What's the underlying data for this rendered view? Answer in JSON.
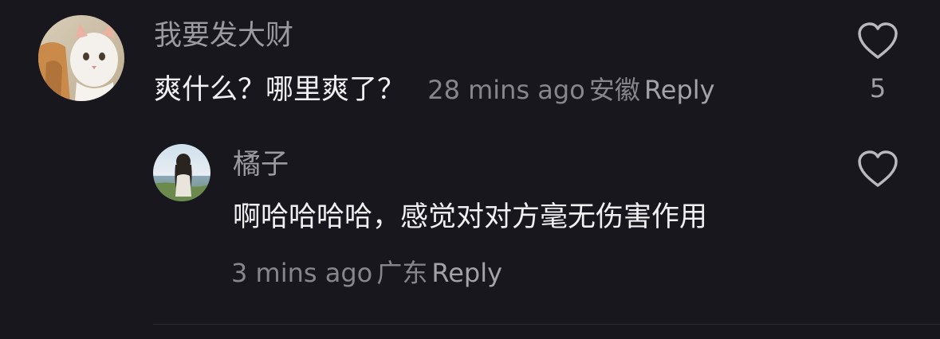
{
  "comment": {
    "username": "我要发大财",
    "text": "爽什么？哪里爽了？",
    "time": "28 mins ago",
    "location": "安徽",
    "reply_label": "Reply",
    "like_count": "5",
    "avatar_icon": "cat-avatar-icon",
    "like_icon": "heart-outline-icon"
  },
  "reply": {
    "username": "橘子",
    "text": "啊哈哈哈哈，感觉对对方毫无伤害作用",
    "time": "3 mins ago",
    "location": "广东",
    "reply_label": "Reply",
    "avatar_icon": "girl-lakeside-avatar-icon",
    "like_icon": "heart-outline-icon"
  },
  "colors": {
    "background": "#17171d",
    "primary_text": "#f0f0f2",
    "secondary_text": "#9a9aa0",
    "divider": "#2c2c33"
  }
}
